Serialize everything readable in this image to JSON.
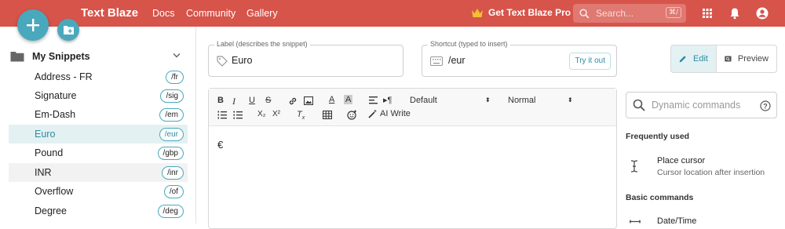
{
  "topbar": {
    "brand": "Text Blaze",
    "nav": [
      "Docs",
      "Community",
      "Gallery"
    ],
    "pro": "Get Text Blaze Pro",
    "search_placeholder": "Search...",
    "search_shortcut": "⌘/"
  },
  "sidebar": {
    "folder": "My Snippets",
    "snippets": [
      {
        "name": "Address - FR",
        "shortcut": "/fr"
      },
      {
        "name": "Signature",
        "shortcut": "/sig"
      },
      {
        "name": "Em-Dash",
        "shortcut": "/em"
      },
      {
        "name": "Euro",
        "shortcut": "/eur"
      },
      {
        "name": "Pound",
        "shortcut": "/gbp"
      },
      {
        "name": "INR",
        "shortcut": "/inr"
      },
      {
        "name": "Overflow",
        "shortcut": "/of"
      },
      {
        "name": "Degree",
        "shortcut": "/deg"
      }
    ]
  },
  "label_field": {
    "label": "Label (describes the snippet)",
    "value": "Euro"
  },
  "shortcut_field": {
    "label": "Shortcut (typed to insert)",
    "value": "/eur",
    "button": "Try it out"
  },
  "mode": {
    "edit": "Edit",
    "preview": "Preview"
  },
  "toolbar": {
    "font": "Default",
    "size": "Normal",
    "ai_write": "AI Write",
    "sub": "X₂",
    "sup": "X²"
  },
  "editor": {
    "content": "€"
  },
  "right": {
    "search_placeholder": "Dynamic commands",
    "section_frequent": "Frequently used",
    "place_cursor_title": "Place cursor",
    "place_cursor_desc": "Cursor location after insertion",
    "section_basic": "Basic commands",
    "datetime_title": "Date/Time"
  },
  "colors": {
    "brand": "#d6544a",
    "accent": "#4aa8bc",
    "selected_bg": "#e3f1f3"
  }
}
